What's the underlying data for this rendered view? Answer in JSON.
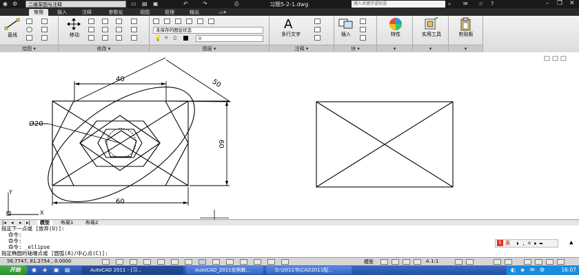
{
  "titlebar": {
    "workspace": "二维草图与注释",
    "title": "习题5-2-1.dwg",
    "search_placeholder": "键入关键字或短语"
  },
  "tabs": [
    "常用",
    "插入",
    "注释",
    "参数化",
    "视图",
    "管理",
    "输出"
  ],
  "ribbon": {
    "draw_line_label": "直线",
    "move_label": "移动",
    "layer_state": "未保存的图层状态",
    "layer_current": "0",
    "multiline_text_label": "多行文字",
    "insert_label": "插入",
    "properties_label": "特性",
    "utilities_label": "实用工具",
    "clipboard_label": "剪贴板",
    "panels": {
      "draw": "绘图",
      "modify": "修改",
      "layers": "图层",
      "annotation": "注释",
      "block": "块"
    },
    "text_icon_glyph": "A"
  },
  "drawing": {
    "dim_top": "40",
    "dim_diag": "50",
    "dim_right": "60",
    "dim_bottom": "60",
    "dim_diameter": "Ø20",
    "ucs_y": "Y",
    "ucs_x": "X"
  },
  "layout_tabs": [
    "模型",
    "布局1",
    "布局2"
  ],
  "command_lines": [
    "指定下一点或 [放弃(U)]:",
    "命令:",
    "命令:",
    "命令: _ellipse",
    "指定椭圆的轴端点或 [圆弧(A)/中心点(C)]:"
  ],
  "ime": {
    "label": "英"
  },
  "status": {
    "coordinates": "56.7747,  81.2754 , 0.0000",
    "space": "模型",
    "scale": "A 1:1"
  },
  "taskbar": {
    "start": "开始",
    "items": [
      "AutoCAD 2011 - [习...",
      "AutoCAD_2011实例教...",
      "D:\\2011书\\CAD2011配..."
    ],
    "clock": "16:07"
  },
  "colors": {
    "titlebar": "#1a1a1a",
    "taskbar": "#2450a8",
    "start": "#2e8b2e"
  }
}
